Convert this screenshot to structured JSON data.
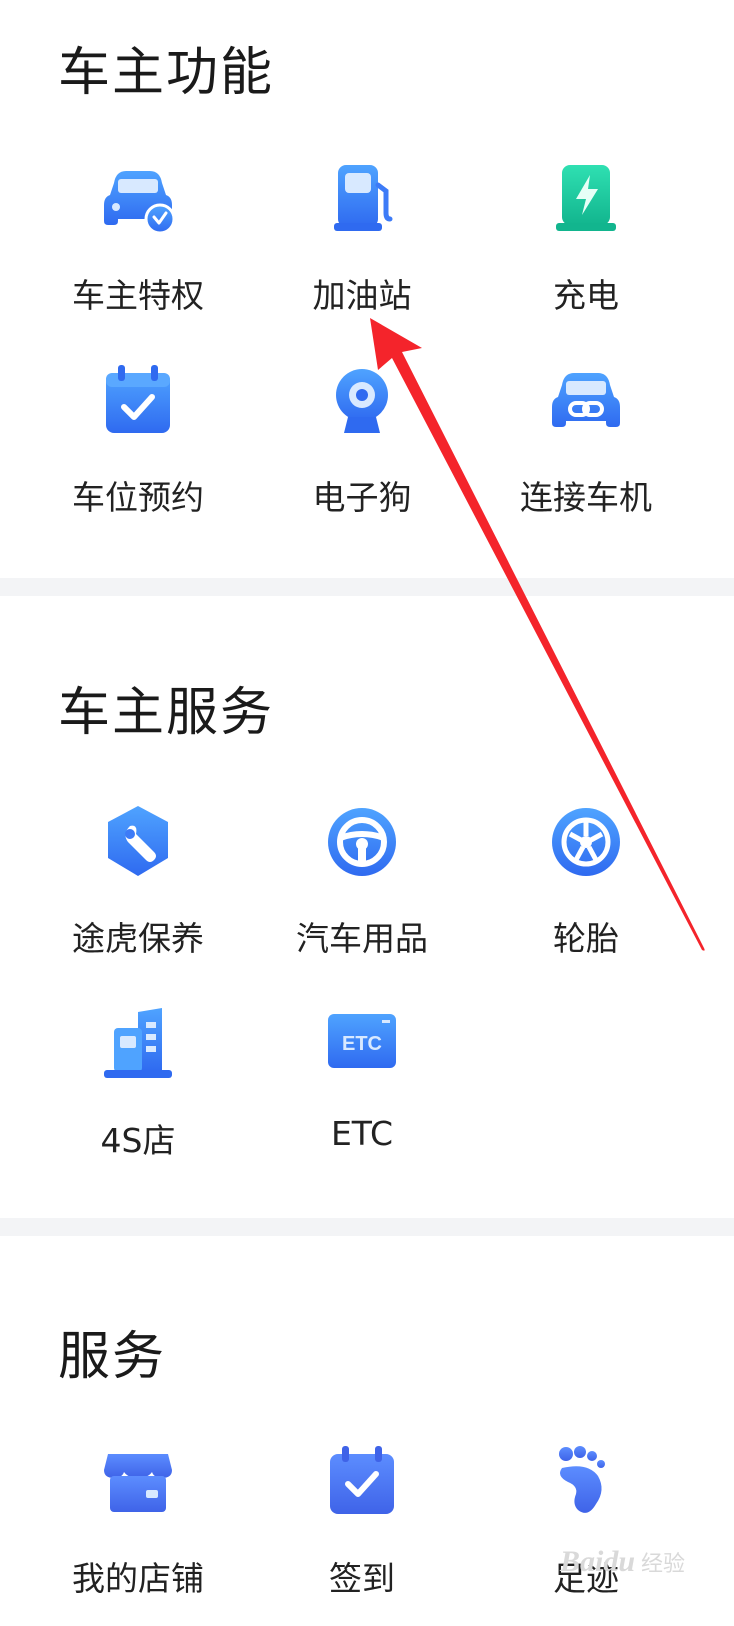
{
  "sections": [
    {
      "title": "车主功能",
      "items": [
        {
          "label": "车主特权",
          "icon": "car-badge-icon"
        },
        {
          "label": "加油站",
          "icon": "fuel-pump-icon"
        },
        {
          "label": "充电",
          "icon": "charging-station-icon"
        },
        {
          "label": "车位预约",
          "icon": "calendar-check-icon"
        },
        {
          "label": "电子狗",
          "icon": "speed-camera-icon"
        },
        {
          "label": "连接车机",
          "icon": "car-link-icon"
        }
      ]
    },
    {
      "title": "车主服务",
      "items": [
        {
          "label": "途虎保养",
          "icon": "wrench-icon"
        },
        {
          "label": "汽车用品",
          "icon": "steering-wheel-icon"
        },
        {
          "label": "轮胎",
          "icon": "tire-icon"
        },
        {
          "label": "4S店",
          "icon": "dealership-icon"
        },
        {
          "label": "ETC",
          "icon": "etc-card-icon"
        }
      ]
    },
    {
      "title": "服务",
      "items": [
        {
          "label": "我的店铺",
          "icon": "shop-icon"
        },
        {
          "label": "签到",
          "icon": "calendar-checkin-icon"
        },
        {
          "label": "足迹",
          "icon": "footprint-icon"
        }
      ]
    }
  ],
  "watermark": {
    "brand": "Baidu",
    "sub": "经验"
  },
  "colors": {
    "accent_blue": "#3d7bf7",
    "accent_green": "#1fc8a0",
    "annotation_arrow": "#f4242b",
    "divider": "#f3f4f6"
  }
}
